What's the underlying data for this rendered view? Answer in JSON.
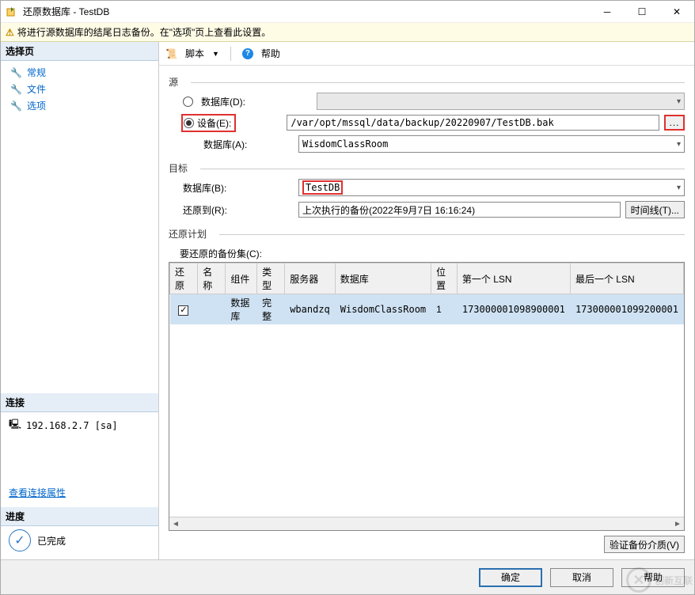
{
  "window": {
    "title": "还原数据库 - TestDB"
  },
  "notice": "将进行源数据库的结尾日志备份。在\"选项\"页上查看此设置。",
  "left": {
    "select_header": "选择页",
    "nav": [
      "常规",
      "文件",
      "选项"
    ],
    "conn_header": "连接",
    "conn_host": "192.168.2.7 [sa]",
    "view_props": "查看连接属性",
    "progress_header": "进度",
    "progress_status": "已完成"
  },
  "toolbar": {
    "script": "脚本",
    "help": "帮助"
  },
  "source": {
    "header": "源",
    "radio_db": "数据库(D):",
    "radio_device": "设备(E):",
    "device_path": "/var/opt/mssql/data/backup/20220907/TestDB.bak",
    "db_label": "数据库(A):",
    "db_value": "WisdomClassRoom"
  },
  "target": {
    "header": "目标",
    "db_label": "数据库(B):",
    "db_value": "TestDB",
    "restore_to_label": "还原到(R):",
    "restore_to_value": "上次执行的备份(2022年9月7日 16:16:24)",
    "timeline_btn": "时间线(T)..."
  },
  "plan": {
    "header": "还原计划",
    "sets_label": "要还原的备份集(C):",
    "columns": {
      "restore": "还原",
      "name": "名称",
      "component": "组件",
      "type": "类型",
      "server": "服务器",
      "database": "数据库",
      "position": "位置",
      "first_lsn": "第一个 LSN",
      "last_lsn": "最后一个 LSN"
    },
    "rows": [
      {
        "restore": true,
        "name": "",
        "component": "数据库",
        "type": "完整",
        "server": "wbandzq",
        "database": "WisdomClassRoom",
        "position": "1",
        "first_lsn": "173000001098900001",
        "last_lsn": "173000001099200001"
      }
    ],
    "verify_btn": "验证备份介质(V)"
  },
  "footer": {
    "ok": "确定",
    "cancel": "取消",
    "help": "帮助"
  },
  "watermark": "创新互联"
}
